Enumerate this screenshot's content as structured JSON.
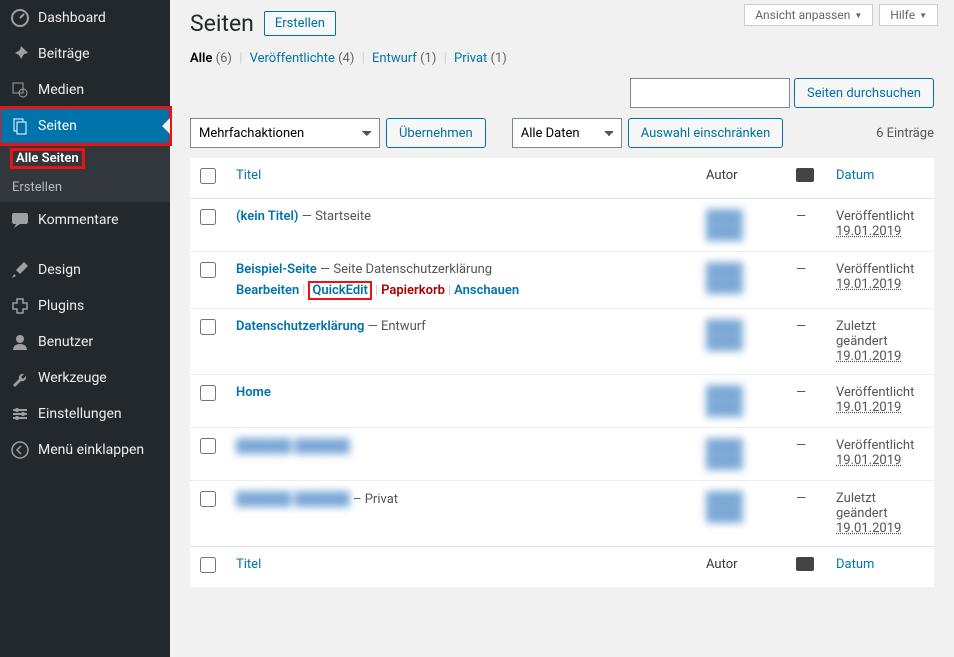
{
  "sidebar": {
    "items": [
      {
        "label": "Dashboard",
        "icon": "dash"
      },
      {
        "label": "Beiträge",
        "icon": "pin"
      },
      {
        "label": "Medien",
        "icon": "media"
      },
      {
        "label": "Seiten",
        "icon": "page",
        "current": true
      },
      {
        "label": "Kommentare",
        "icon": "comment"
      },
      {
        "label": "Design",
        "icon": "brush"
      },
      {
        "label": "Plugins",
        "icon": "plugin"
      },
      {
        "label": "Benutzer",
        "icon": "user"
      },
      {
        "label": "Werkzeuge",
        "icon": "tools"
      },
      {
        "label": "Einstellungen",
        "icon": "settings"
      },
      {
        "label": "Menü einklappen",
        "icon": "collapse"
      }
    ],
    "submenu": [
      {
        "label": "Alle Seiten",
        "current": true
      },
      {
        "label": "Erstellen"
      }
    ]
  },
  "topright": {
    "screen_options": "Ansicht anpassen",
    "help": "Hilfe"
  },
  "header": {
    "title": "Seiten",
    "add_new": "Erstellen"
  },
  "filters": {
    "all": {
      "label": "Alle",
      "count": "(6)"
    },
    "published": {
      "label": "Veröffentlichte",
      "count": "(4)"
    },
    "draft": {
      "label": "Entwurf",
      "count": "(1)"
    },
    "private": {
      "label": "Privat",
      "count": "(1)"
    }
  },
  "search": {
    "button": "Seiten durchsuchen"
  },
  "bulk": {
    "actions": "Mehrfachaktionen",
    "apply": "Übernehmen",
    "dates": "Alle Daten",
    "filter": "Auswahl einschränken"
  },
  "count_text": "6 Einträge",
  "columns": {
    "title": "Titel",
    "author": "Autor",
    "date": "Datum"
  },
  "row_actions": {
    "edit": "Bearbeiten",
    "quickedit": "QuickEdit",
    "trash": "Papierkorb",
    "view": "Anschauen"
  },
  "rows": [
    {
      "title": "(kein Titel)",
      "state": " — Startseite",
      "author_blur": "████ ████",
      "comments": "—",
      "status": "Veröffentlicht",
      "date": "19.01.2019"
    },
    {
      "title": "Beispiel-Seite",
      "state": " — Seite Datenschutzerklärung",
      "author_blur": "████ ████",
      "comments": "—",
      "status": "Veröffentlicht",
      "date": "19.01.2019",
      "actions": true
    },
    {
      "title": "Datenschutzerklärung",
      "state": " — Entwurf",
      "author_blur": "████ ████",
      "comments": "—",
      "status": "Zuletzt geändert",
      "date": "19.01.2019"
    },
    {
      "title": "Home",
      "state": "",
      "author_blur": "████ ████",
      "comments": "—",
      "status": "Veröffentlicht",
      "date": "19.01.2019"
    },
    {
      "title_blur": "██████ ██████",
      "state": "",
      "author_blur": "████ ████",
      "comments": "—",
      "status": "Veröffentlicht",
      "date": "19.01.2019"
    },
    {
      "title_blur": "██████ ██████",
      "state": " – Privat",
      "author_blur": "████ ████",
      "comments": "—",
      "status": "Zuletzt geändert",
      "date": "19.01.2019"
    }
  ]
}
